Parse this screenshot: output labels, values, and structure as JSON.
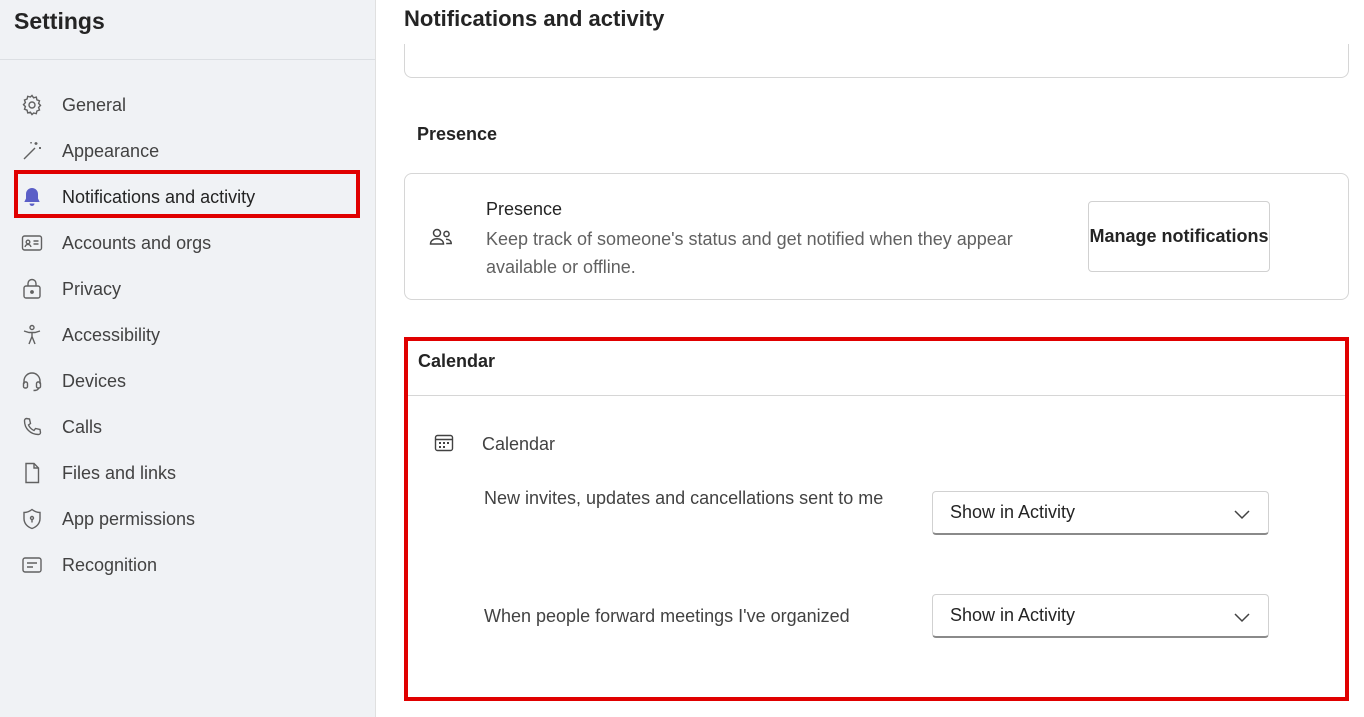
{
  "sidebar": {
    "title": "Settings",
    "items": [
      {
        "label": "General",
        "icon": "gear-icon"
      },
      {
        "label": "Appearance",
        "icon": "magic-wand-icon"
      },
      {
        "label": "Notifications and activity",
        "icon": "bell-icon",
        "active": true
      },
      {
        "label": "Accounts and orgs",
        "icon": "id-card-icon"
      },
      {
        "label": "Privacy",
        "icon": "lock-icon"
      },
      {
        "label": "Accessibility",
        "icon": "accessibility-icon"
      },
      {
        "label": "Devices",
        "icon": "headset-icon"
      },
      {
        "label": "Calls",
        "icon": "phone-icon"
      },
      {
        "label": "Files and links",
        "icon": "document-icon"
      },
      {
        "label": "App permissions",
        "icon": "shield-icon"
      },
      {
        "label": "Recognition",
        "icon": "badge-icon"
      }
    ]
  },
  "main": {
    "title": "Notifications and activity",
    "presence_section": {
      "heading": "Presence",
      "card": {
        "title": "Presence",
        "description": "Keep track of someone's status and get notified when they appear available or offline.",
        "button_label": "Manage notifications"
      }
    },
    "calendar_section": {
      "heading": "Calendar",
      "subheading": "Calendar",
      "settings": [
        {
          "label": "New invites, updates and cancellations sent to me",
          "value": "Show in Activity"
        },
        {
          "label": "When people forward meetings I've organized",
          "value": "Show in Activity"
        }
      ]
    }
  },
  "colors": {
    "accent": "#5b5fc7",
    "highlight": "#e00000",
    "sidebar_bg": "#f0f2f5"
  }
}
